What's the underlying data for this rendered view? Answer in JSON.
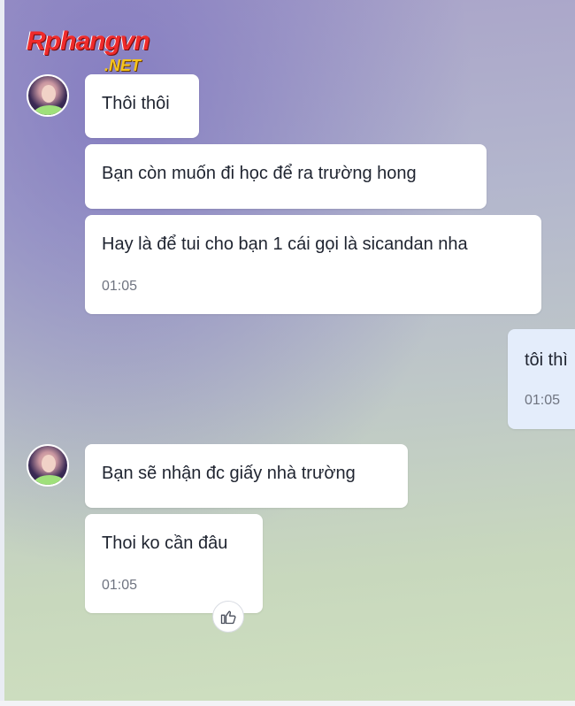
{
  "logo": {
    "main": "Rphangvn",
    "sub": ".NET"
  },
  "messages": [
    {
      "text": "Thôi thôi"
    },
    {
      "text": "Bạn còn muốn đi học để ra trường hong"
    },
    {
      "text": "Hay là để tui cho bạn 1 cái gọi là sicandan nha",
      "time": "01:05"
    },
    {
      "text": "tôi thì",
      "time": "01:05"
    },
    {
      "text": "Bạn sẽ nhận đc giấy nhà trường"
    },
    {
      "text": "Thoi ko cần đâu",
      "time": "01:05"
    }
  ],
  "icons": {
    "avatar": "avatar-icon",
    "like": "thumbs-up-icon"
  },
  "colors": {
    "bubble_other": "#ffffff",
    "bubble_me": "#e4edfb",
    "time_text": "#6f7480",
    "logo_red": "#ef2b2b",
    "logo_gold": "#f7c41a"
  }
}
